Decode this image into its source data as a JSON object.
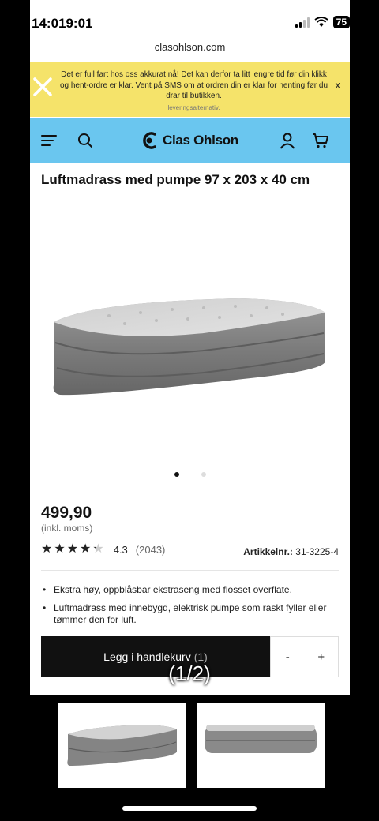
{
  "status_bar": {
    "time": "14:019:01",
    "battery": "75"
  },
  "browser": {
    "url": "clasohlson.com"
  },
  "banner": {
    "text": "Det er full fart hos oss akkurat nå! Det kan derfor ta litt lengre tid før din klikk og hent-ordre er klar. Vent på SMS om at ordren din er klar for henting før du drar til butikken.",
    "overflow_text": "leveringsalternativ.",
    "close_label": "x",
    "color": "#f5e36a"
  },
  "header": {
    "logo_text": "Clas Ohlson",
    "color": "#6ac6ef",
    "icons": [
      "menu-icon",
      "search-icon",
      "account-icon",
      "cart-icon"
    ]
  },
  "product": {
    "title": "Luftmadrass med pumpe 97 x 203 x 40 cm",
    "price": "499,90",
    "vat_note": "(inkl. moms)",
    "rating_stars": 4.3,
    "rating_value": "4.3",
    "rating_count": "(2043)",
    "article_label": "Artikkelnr.:",
    "article_number": "31-3225-4",
    "image_dots": 2,
    "active_dot": 0,
    "bullets": [
      "Ekstra høy, oppblåsbar ekstraseng med flosset overflate.",
      "Luftmadrass med innebygd, elektrisk pumpe som raskt fyller eller tømmer den for luft."
    ]
  },
  "cart": {
    "add_label": "Legg i handlekurv",
    "quantity": "(1)",
    "minus": "-",
    "plus": "+"
  },
  "gallery": {
    "counter": "(1/2)"
  }
}
